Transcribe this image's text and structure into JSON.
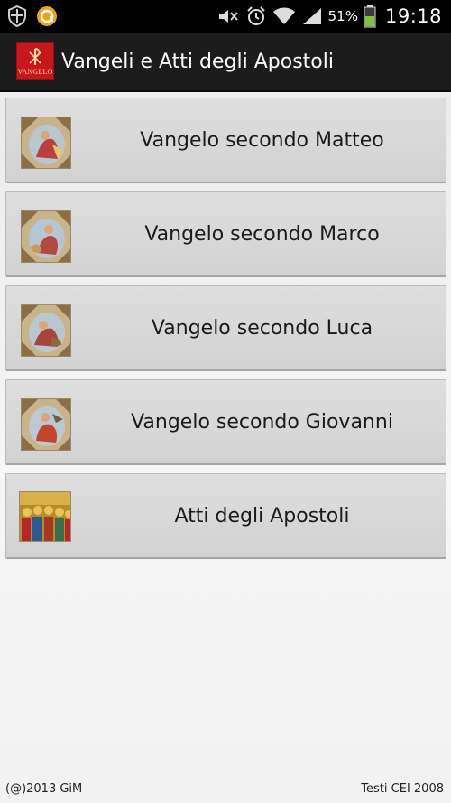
{
  "status_bar": {
    "battery_percent": "51%",
    "time": "19:18",
    "icons": [
      "shield-icon",
      "lastfm-icon",
      "mute-icon",
      "alarm-icon",
      "wifi-icon",
      "signal-icon",
      "battery-icon"
    ]
  },
  "action_bar": {
    "logo_text": "VANGELO",
    "title": "Vangeli e Atti degli Apostoli",
    "accent": "#c8161d"
  },
  "books": [
    {
      "label": "Vangelo secondo Matteo",
      "icon": "matthew-fresco-thumbnail"
    },
    {
      "label": "Vangelo secondo Marco",
      "icon": "mark-fresco-thumbnail"
    },
    {
      "label": "Vangelo secondo Luca",
      "icon": "luke-fresco-thumbnail"
    },
    {
      "label": "Vangelo secondo Giovanni",
      "icon": "john-fresco-thumbnail"
    },
    {
      "label": "Atti degli Apostoli",
      "icon": "apostles-painting-thumbnail"
    }
  ],
  "footer": {
    "left": "(@)2013 GiM",
    "right": "Testi CEI 2008"
  }
}
